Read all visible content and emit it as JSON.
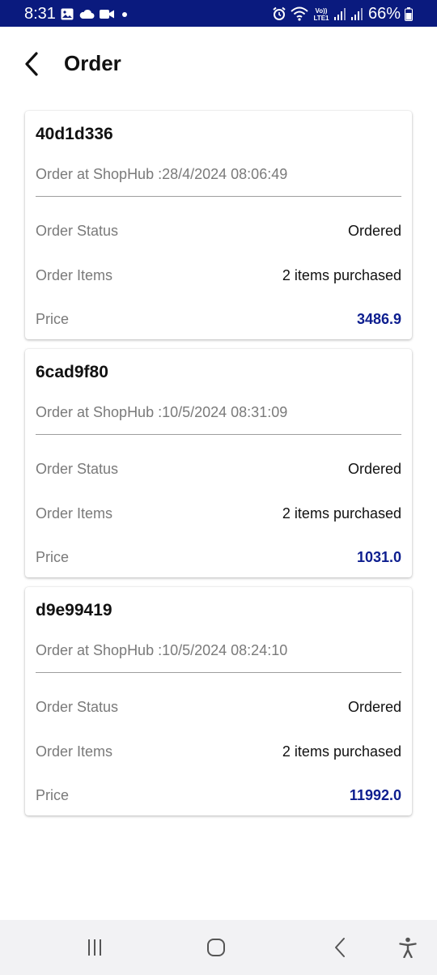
{
  "status_bar": {
    "time": "8:31",
    "battery": "66%",
    "icons": [
      "gallery-icon",
      "cloud-icon",
      "video-icon",
      "dot-icon",
      "alarm-icon",
      "wifi-icon",
      "volte-icon",
      "signal-icon",
      "signal-icon",
      "battery-icon"
    ]
  },
  "header": {
    "title": "Order",
    "back_icon": "chevron-left-icon"
  },
  "orders": [
    {
      "id": "40d1d336",
      "date": "Order at ShopHub :28/4/2024 08:06:49",
      "status_label": "Order Status",
      "status_value": "Ordered",
      "items_label": "Order Items",
      "items_value": "2 items purchased",
      "price_label": "Price",
      "price_value": "3486.9"
    },
    {
      "id": "6cad9f80",
      "date": "Order at ShopHub :10/5/2024 08:31:09",
      "status_label": "Order Status",
      "status_value": "Ordered",
      "items_label": "Order Items",
      "items_value": "2 items purchased",
      "price_label": "Price",
      "price_value": "1031.0"
    },
    {
      "id": "d9e99419",
      "date": "Order at ShopHub :10/5/2024 08:24:10",
      "status_label": "Order Status",
      "status_value": "Ordered",
      "items_label": "Order Items",
      "items_value": "2 items purchased",
      "price_label": "Price",
      "price_value": "11992.0"
    }
  ],
  "colors": {
    "status_bar": "#0a1a7e",
    "price": "#0d1e8f",
    "label": "#7a7a7a",
    "nav_bar": "#f2f2f4"
  },
  "nav_bar": {
    "icons": [
      "recent-apps-icon",
      "home-icon",
      "back-icon",
      "accessibility-icon"
    ]
  }
}
